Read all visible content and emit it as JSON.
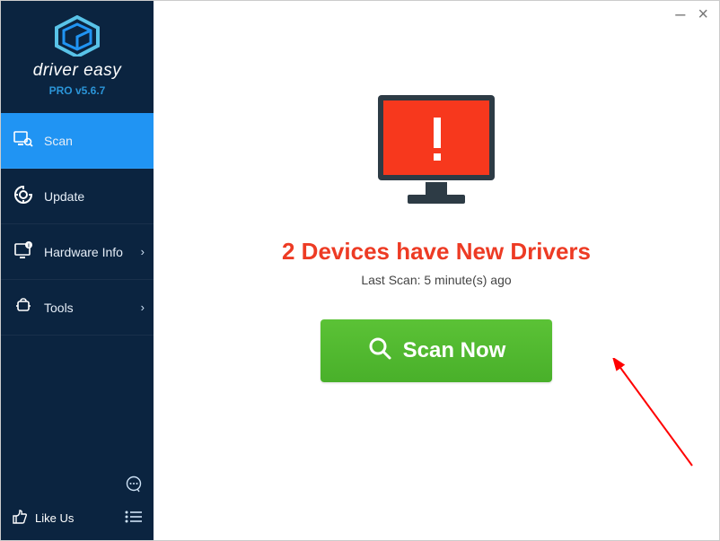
{
  "brand": {
    "name": "driver easy",
    "version_prefix": "PRO ",
    "version": "v5.6.7"
  },
  "sidebar": {
    "items": [
      {
        "label": "Scan",
        "has_chevron": false,
        "active": true
      },
      {
        "label": "Update",
        "has_chevron": false,
        "active": false
      },
      {
        "label": "Hardware Info",
        "has_chevron": true,
        "active": false
      },
      {
        "label": "Tools",
        "has_chevron": true,
        "active": false
      }
    ],
    "like_us": "Like Us"
  },
  "titlebar": {
    "minimize": "–",
    "close": "×"
  },
  "main": {
    "status_title": "2 Devices have New Drivers",
    "last_scan": "Last Scan: 5 minute(s) ago",
    "scan_button": "Scan Now"
  },
  "colors": {
    "sidebar_bg": "#0b2440",
    "accent_blue": "#2094f3",
    "brand_blue_light": "#59c3e8",
    "alert_red": "#ed3b24",
    "alert_fill": "#f7381d",
    "scan_green": "#4fb72e",
    "monitor_dark": "#2d3b45"
  }
}
